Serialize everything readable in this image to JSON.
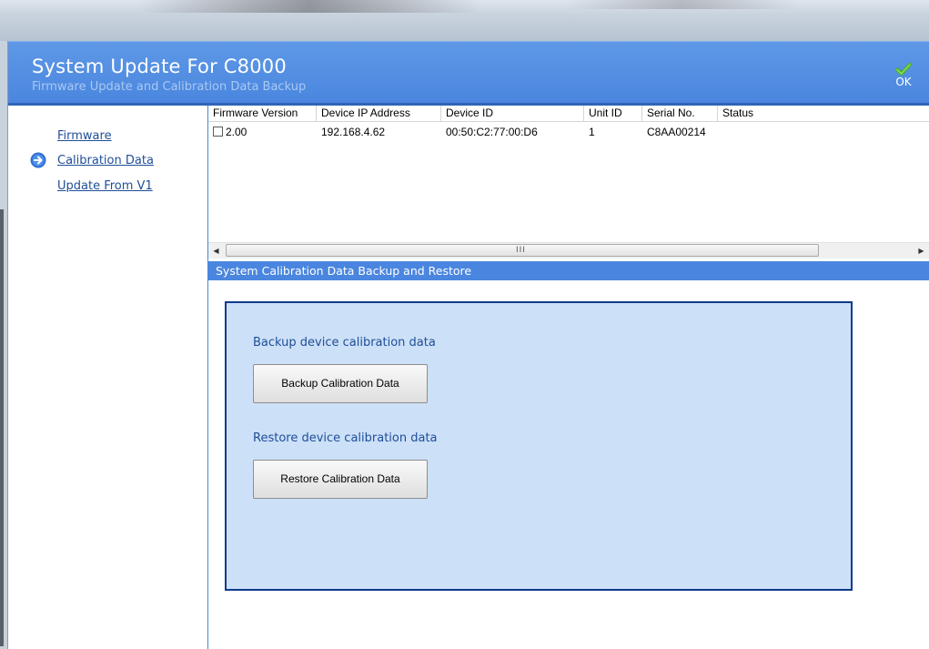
{
  "header": {
    "title": "System Update For C8000",
    "subtitle": "Firmware Update and Calibration Data Backup",
    "ok_label": "OK"
  },
  "sidebar": {
    "items": [
      {
        "label": "Firmware",
        "selected": false
      },
      {
        "label": "Calibration Data",
        "selected": true
      },
      {
        "label": "Update From V1",
        "selected": false
      }
    ]
  },
  "device_table": {
    "columns": [
      "Firmware Version",
      "Device IP Address",
      "Device ID",
      "Unit ID",
      "Serial No.",
      "Status"
    ],
    "rows": [
      {
        "checked": false,
        "firmware_version": "2.00",
        "ip_address": "192.168.4.62",
        "device_id": "00:50:C2:77:00:D6",
        "unit_id": "1",
        "serial_no": "C8AA00214",
        "status": ""
      }
    ]
  },
  "scrollbar": {
    "left_arrow": "◀",
    "right_arrow": "▶",
    "grip": "III"
  },
  "section": {
    "title": "System Calibration Data Backup and Restore",
    "backup_label": "Backup device calibration data",
    "backup_button": "Backup Calibration Data",
    "restore_label": "Restore device calibration data",
    "restore_button": "Restore Calibration Data"
  },
  "icons": {
    "ok": "check-icon",
    "nav_selected": "arrow-right-circle-icon"
  },
  "colors": {
    "header_blue": "#4a86df",
    "panel_fill": "#cce0f8",
    "panel_border": "#0f3a8a",
    "link": "#1f4e97",
    "ok_check": "#4cae2c"
  }
}
